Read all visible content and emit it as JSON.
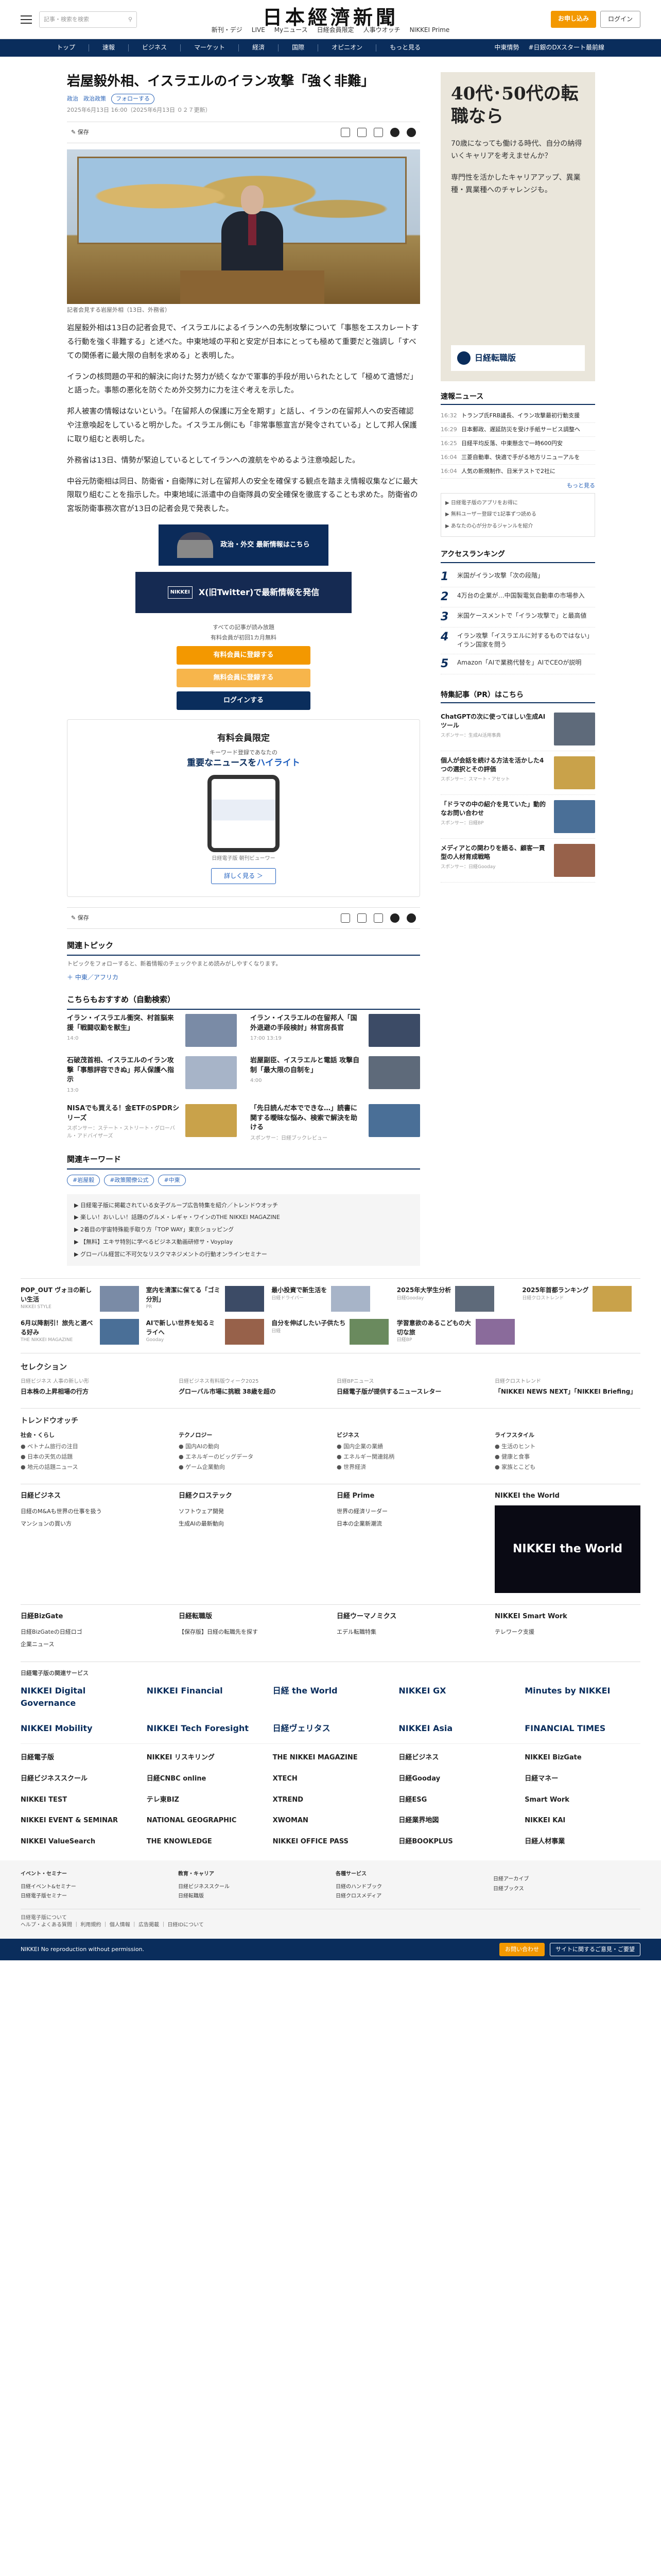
{
  "header": {
    "search_placeholder": "記事・検索を検索",
    "logo": "日本經濟新聞",
    "subnav": [
      "新刊・デジ",
      "LIVE",
      "Myニュース",
      "日経会員限定",
      "人事ウオッチ",
      "NIKKEI Prime"
    ],
    "btn_subscribe": "お申し込み",
    "btn_login": "ログイン"
  },
  "mainnav": {
    "items": [
      "トップ",
      "速報",
      "ビジネス",
      "マーケット",
      "経済",
      "国際",
      "オピニオン",
      "もっと見る"
    ],
    "right": [
      "中東情勢",
      "#日銀のDXスタート最前線"
    ]
  },
  "article": {
    "title": "岩屋毅外相、イスラエルのイラン攻撃「強く非難」",
    "tags": [
      "政治",
      "政治政策"
    ],
    "follow": "フォローする",
    "dates": "2025年6月13日 16:00（2025年6月13日 ０２７更新）",
    "save": "保存",
    "caption": "記者会見する岩屋外相（13日、外務省）",
    "paragraphs": [
      "岩屋毅外相は13日の記者会見で、イスラエルによるイランへの先制攻撃について「事態をエスカレートする行動を強く非難する」と述べた。中東地域の平和と安定が日本にとっても極めて重要だと強調し「すべての関係者に最大限の自制を求める」と表明した。",
      "イランの核問題の平和的解決に向けた努力が続くなかで軍事的手段が用いられたとして「極めて遺憾だ」と語った。事態の悪化を防ぐため外交努力に力を注ぐ考えを示した。",
      "邦人被害の情報はないという。「在留邦人の保護に万全を期す」と話し、イランの在留邦人への安否確認や注意喚起をしていると明かした。イスラエル側にも「非常事態宣言が発令されている」として邦人保護に取り組むと表明した。",
      "外務省は13日、情勢が緊迫しているとしてイランへの渡航をやめるよう注意喚起した。",
      "中谷元防衛相は同日、防衛省・自衛隊に対し在留邦人の安全を確保する観点を踏まえ情報収集などに最大限取り組むことを指示した。中東地域に派遣中の自衛隊員の安全確保を徹底することも求めた。防衛省の宮坂防衛事務次官が13日の記者会見で発表した。"
    ],
    "banner1": "政治・外交 最新情報はこちら",
    "banner2_tag": "NIKKEI",
    "banner2": "X(旧Twitter)で最新情報を発信",
    "paywall_text1": "すべての記事が読み放題",
    "paywall_text2": "有料会員が初回1カ月無料",
    "paywall_b1": "有料会員に登録する",
    "paywall_b2": "無料会員に登録する",
    "paywall_b3": "ログインする",
    "promo_head": "有料会員限定",
    "promo_sub": "キーワード登録であなたの",
    "promo_main1": "重要なニュースを",
    "promo_main2": "ハイライト",
    "promo_cap": "日経電子版 朝刊ビューワー",
    "promo_more": "詳しく見る ＞"
  },
  "related": {
    "heading": "関連トピック",
    "note": "トピックをフォローすると、新着情報のチェックやまとめ読みがしやすくなります。",
    "link": "中東／アフリカ"
  },
  "recommend": {
    "heading": "こちらもおすすめ（自動検索）",
    "items": [
      {
        "title": "イラン・イスラエル衝突、村首脳来援「戦闘収勤を獣生」",
        "src": "14:0"
      },
      {
        "title": "イラン・イスラエルの在留邦人「国外退避の手段検討」林官房長官",
        "src": "17:00 13:19"
      },
      {
        "title": "石破茂首相、イスラエルのイラン攻撃「事態評容できぬ」邦人保護へ指示",
        "src": "13:0"
      },
      {
        "title": "岩屋副臣、イスラエルと電話 攻撃自制「最大限の自制を」",
        "src": "4:00"
      },
      {
        "title": "NISAでも買える！金ETFのSPDRシリーズ",
        "src": "スポンサー：ステート・ストリート・グローバル・アドバイザーズ"
      },
      {
        "title": "「先日読んだ本でできな…」読書に関する曖昧な悩み、検索で解決を助ける",
        "src": "スポンサー：日経ブックレビュー"
      }
    ]
  },
  "keywords": {
    "heading": "関連キーワード",
    "items": [
      "#岩屋毅",
      "#政策閣僚公式",
      "#中東"
    ]
  },
  "adlist": [
    "日経電子版に掲載されている女子グループ広告特集を紹介／トレンドウオッチ",
    "楽しい！おいしい！話題のグルメ・レギャ・ワインのTHE NIKKEI MAGAZINE",
    "2着目の宇宙特殊能手取り方「TOP WAY」東京ショッピング",
    "【無料】エキサ特別に学べるビジネス動画研修サ・Voyplay",
    "グローバル経営に不可欠なリスクマネジメントの行動オンラインセミナー"
  ],
  "sidebar": {
    "ad_title": "40代･50代の転職なら",
    "ad_p1": "70歳になっても働ける時代、自分の納得いくキャリアを考えませんか？",
    "ad_p2": "専門性を活かしたキャリアアップ、異業種・異業種へのチャレンジも。",
    "ad_brand": "日経転職版",
    "news_heading": "速報ニュース",
    "news": [
      {
        "time": "16:32",
        "text": "トランプ氏FRB議長、イラン攻撃最初行動支援"
      },
      {
        "time": "16:29",
        "text": "日本郵政、遅延防災を受け手紙サービス調整へ"
      },
      {
        "time": "16:25",
        "text": "日経平均反落、中東懸念で一時600円安"
      },
      {
        "time": "16:04",
        "text": "三菱自動車、快適で手がる地方リニューアルを"
      },
      {
        "time": "16:04",
        "text": "人気の新規制作、日米テストで2社に"
      }
    ],
    "news_more": "もっと見る",
    "linkbox": [
      "日経電子版のアプリをお得に",
      "無料ユーザー登録で1記事ずつ読める",
      "あなたの心が分かるジャンルを紹介"
    ],
    "rank_heading": "アクセスランキング",
    "rank": [
      "米国がイラン攻撃「次の段階」",
      "4万台の企業が…中国製電気自動車の市場参入",
      "米国ケースメントで「イラン攻撃で」と最高値",
      "イラン攻撃「イスラエルに対するものではない」イラン国家を問う",
      "Amazon「AIで業務代替を」AIでCEOが説明"
    ],
    "feat_heading": "特集記事（PR）はこちら",
    "feats": [
      {
        "t": "ChatGPTの次に使ってほしい生成AIツール",
        "s": "スポンサー：生成AI活用事典"
      },
      {
        "t": "個人が会話を続ける方法を活かした4つの選択とその評価",
        "s": "スポンサー：スマート・アセット"
      },
      {
        "t": "「ドラマの中の紹介を見ていた」動的なお問い合わせ",
        "s": "スポンサー：日経BP"
      },
      {
        "t": "メディアとの関わりを語る、顧客一貫型の人材育成戦略",
        "s": "スポンサー：日経Gooday"
      }
    ]
  },
  "strip": [
    {
      "t": "POP_OUT ヴォヨの新しい生活",
      "s": "NIKKEI STYLE"
    },
    {
      "t": "室内を清潔に保てる「ゴミ分別」",
      "s": "PR"
    },
    {
      "t": "最小投資で新生活を",
      "s": "日経ドライバー"
    },
    {
      "t": "2025年大学生分析",
      "s": "日経Gooday"
    },
    {
      "t": "2025年首都ランキング",
      "s": "日経クロストレンド"
    },
    {
      "t": "6月以降割引！旅先と選べる好み",
      "s": "THE NIKKEI MAGAZINE"
    },
    {
      "t": "AIで新しい世界を知るミライへ",
      "s": "Gooday"
    },
    {
      "t": "自分を伸ばしたい子供たち",
      "s": "日経"
    },
    {
      "t": "学習意欲のあるこどもの大切な旅",
      "s": "日経BP"
    },
    {
      "t": "",
      "s": ""
    }
  ],
  "selection": {
    "heading": "セレクション",
    "items": [
      {
        "k": "日経ビジネス 人事の新しい形",
        "v": "日本株の上昇相場の行方"
      },
      {
        "k": "日経ビジネス有料版ウィーク2025",
        "v": "グローバル市場に挑戦 38歳を超の"
      },
      {
        "k": "日経BPニュース",
        "v": "日経電子版が提供するニュースレター"
      },
      {
        "k": "日経クロストレンド",
        "v": "「NIKKEI NEWS NEXT」「NIKKEI Briefing」"
      }
    ]
  },
  "trend": {
    "heading": "トレンドウオッチ",
    "cols": [
      {
        "h": "社会・くらし",
        "l": [
          "ベトナム旅行の注目",
          "日本の天気の話題",
          "地元の話題ニュース"
        ]
      },
      {
        "h": "テクノロジー",
        "l": [
          "国内AIの動向",
          "エネルギーのビッグデータ",
          "ゲーム企業動向"
        ]
      },
      {
        "h": "ビジネス",
        "l": [
          "国内企業の業績",
          "エネルギー関連銘柄",
          "世界経済"
        ]
      },
      {
        "h": "ライフスタイル",
        "l": [
          "生活のヒント",
          "健康と食事",
          "家族とこども"
        ]
      }
    ]
  },
  "products": [
    {
      "h": "日経ビジネス",
      "items": [
        "日経のM&Aも世界の仕事を扱う",
        "マンションの買い方"
      ]
    },
    {
      "h": "日経クロステック",
      "items": [
        "ソフトウェア開発",
        "生成AIの最新動向"
      ]
    },
    {
      "h": "日経 Prime",
      "items": [
        "世界の経済リーダー",
        "日本の企業新潮流"
      ]
    },
    {
      "h": "NIKKEI the World",
      "items": []
    }
  ],
  "products2": [
    {
      "h": "日経BizGate",
      "items": [
        "日経BizGateの日経ロゴ",
        "企業ニュース"
      ]
    },
    {
      "h": "日経転職版",
      "items": [
        "【保存版】日経の転職先を探す"
      ]
    },
    {
      "h": "日経ウーマノミクス",
      "items": [
        "エデル転職特集"
      ]
    },
    {
      "h": "NIKKEI Smart Work",
      "items": [
        "テレワーク支援"
      ]
    }
  ],
  "logos_heading": "日経電子版の関連サービス",
  "logos": [
    "NIKKEI Digital Governance",
    "NIKKEI Financial",
    "日経 the World",
    "NIKKEI GX",
    "Minutes by NIKKEI",
    "NIKKEI Mobility",
    "NIKKEI Tech Foresight",
    "日経ヴェリタス",
    "NIKKEI Asia",
    "FINANCIAL TIMES"
  ],
  "logos2": [
    "日経電子版",
    "NIKKEI リスキリング",
    "THE NIKKEI MAGAZINE",
    "日経ビジネス",
    "NIKKEI BizGate",
    "日経ビジネススクール",
    "日経CNBC online",
    "XTECH",
    "日経Gooday",
    "日経マネー",
    "NIKKEI TEST",
    "テレ東BIZ",
    "XTREND",
    "日経ESG",
    "Smart Work",
    "NIKKEI EVENT & SEMINAR",
    "NATIONAL GEOGRAPHIC",
    "XWOMAN",
    "日経業界地図",
    "NIKKEI KAI",
    "NIKKEI ValueSearch",
    "THE KNOWLEDGE",
    "NIKKEI OFFICE PASS",
    "日経BOOKPLUS",
    "日経人材事業"
  ],
  "footer": {
    "cols": [
      {
        "h": "イベント・セミナー",
        "l": [
          "日経イベント&セミナー",
          "日経電子版セミナー"
        ]
      },
      {
        "h": "教育・キャリア",
        "l": [
          "日経ビジネススクール",
          "日経転職版"
        ]
      },
      {
        "h": "各種サービス",
        "l": [
          "日経のハンドブック",
          "日経クロスメディア"
        ]
      },
      {
        "h": "",
        "l": [
          "日経アーカイブ",
          "日経ブックス"
        ]
      }
    ],
    "about": "日経電子版について",
    "links": "ヘルプ・よくある質問 ｜ 利用規約 ｜ 個人情報 ｜ 広告掲載 ｜ 日経IDについて",
    "bottom": "NIKKEI No reproduction without permission.",
    "b1": "お問い合わせ",
    "b2": "サイトに関するご意見・ご要望"
  }
}
